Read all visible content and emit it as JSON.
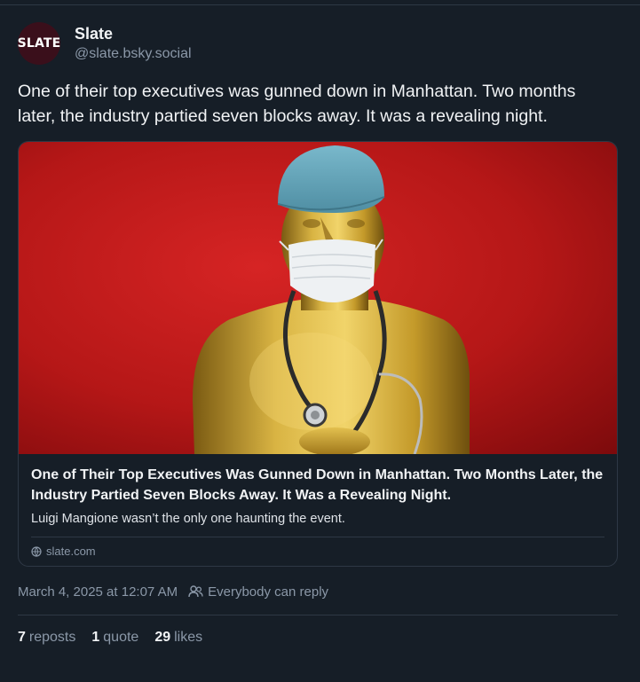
{
  "author": {
    "avatar_text": "SLATE",
    "display_name": "Slate",
    "handle": "@slate.bsky.social"
  },
  "post": {
    "text": "One of their top executives was gunned down in Manhattan. Two months later, the industry partied seven blocks away. It was a revealing night."
  },
  "link_card": {
    "title": "One of Their Top Executives Was Gunned Down in Manhattan. Two Months Later, the Industry Partied Seven Blocks Away. It Was a Revealing Night.",
    "description": "Luigi Mangione wasn’t the only one haunting the event.",
    "domain": "slate.com",
    "domain_icon": "globe-icon",
    "image_subject": "gold statuette wearing surgical cap, mask and stethoscope on red background"
  },
  "meta": {
    "timestamp": "March 4, 2025 at 12:07 AM",
    "reply_icon": "people-icon",
    "reply_setting": "Everybody can reply"
  },
  "stats": {
    "reposts_count": "7",
    "reposts_label": "reposts",
    "quotes_count": "1",
    "quotes_label": "quote",
    "likes_count": "29",
    "likes_label": "likes"
  },
  "colors": {
    "background": "#161e27",
    "border": "#2e3845",
    "muted_text": "#8b98a8",
    "avatar_bg": "#3a0f1b",
    "image_red": "#c41d1d",
    "statue_gold": "#c9a22f",
    "cap_blue": "#6aa9bd"
  }
}
